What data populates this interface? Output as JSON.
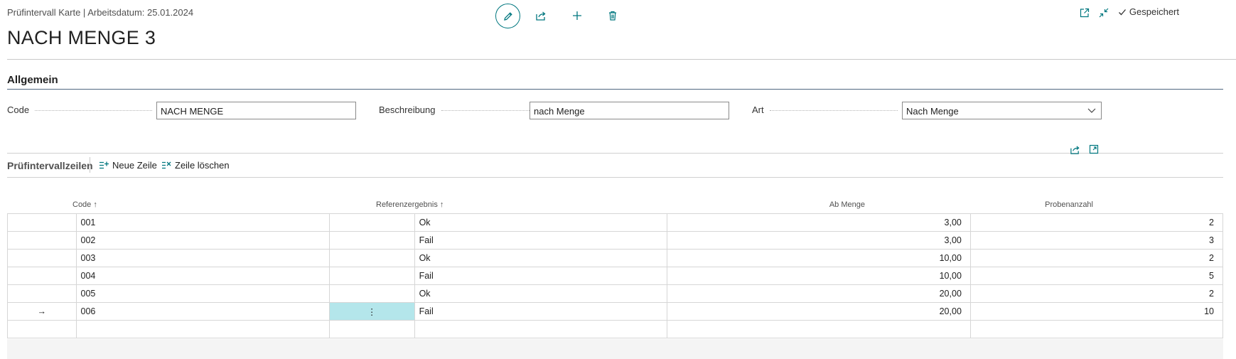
{
  "header": {
    "breadcrumb": "Prüfintervall Karte | Arbeitsdatum: 25.01.2024",
    "title": "NACH MENGE 3",
    "saved_label": "Gespeichert"
  },
  "section": {
    "title": "Allgemein",
    "fields": [
      {
        "label": "Code",
        "value": "NACH MENGE"
      },
      {
        "label": "Beschreibung",
        "value": "nach Menge"
      },
      {
        "label": "Art",
        "value": "Nach Menge"
      }
    ]
  },
  "lines": {
    "title": "Prüfintervallzeilen",
    "new_line": "Neue Zeile",
    "delete_line": "Zeile löschen",
    "columns": {
      "code": "Code",
      "ref": "Referenzergebnis",
      "ab_menge": "Ab Menge",
      "proben": "Probenanzahl"
    },
    "rows": [
      {
        "code": "001",
        "ref": "Ok",
        "ab_menge": "3,00",
        "proben": "2"
      },
      {
        "code": "002",
        "ref": "Fail",
        "ab_menge": "3,00",
        "proben": "3"
      },
      {
        "code": "003",
        "ref": "Ok",
        "ab_menge": "10,00",
        "proben": "2"
      },
      {
        "code": "004",
        "ref": "Fail",
        "ab_menge": "10,00",
        "proben": "5"
      },
      {
        "code": "005",
        "ref": "Ok",
        "ab_menge": "20,00",
        "proben": "2"
      },
      {
        "code": "006",
        "ref": "Fail",
        "ab_menge": "20,00",
        "proben": "10"
      }
    ],
    "current_row_marker": "→",
    "row_menu_icon": "⋮"
  },
  "icons": {
    "edit": "pencil-icon",
    "share": "share-icon",
    "new": "plus-icon",
    "delete": "trash-icon",
    "saved": "check-icon",
    "open_new": "open-in-new-window-icon",
    "collapse": "collapse-icon"
  },
  "colors": {
    "accent": "#00777f",
    "selected_cell": "#b4e6eb"
  }
}
